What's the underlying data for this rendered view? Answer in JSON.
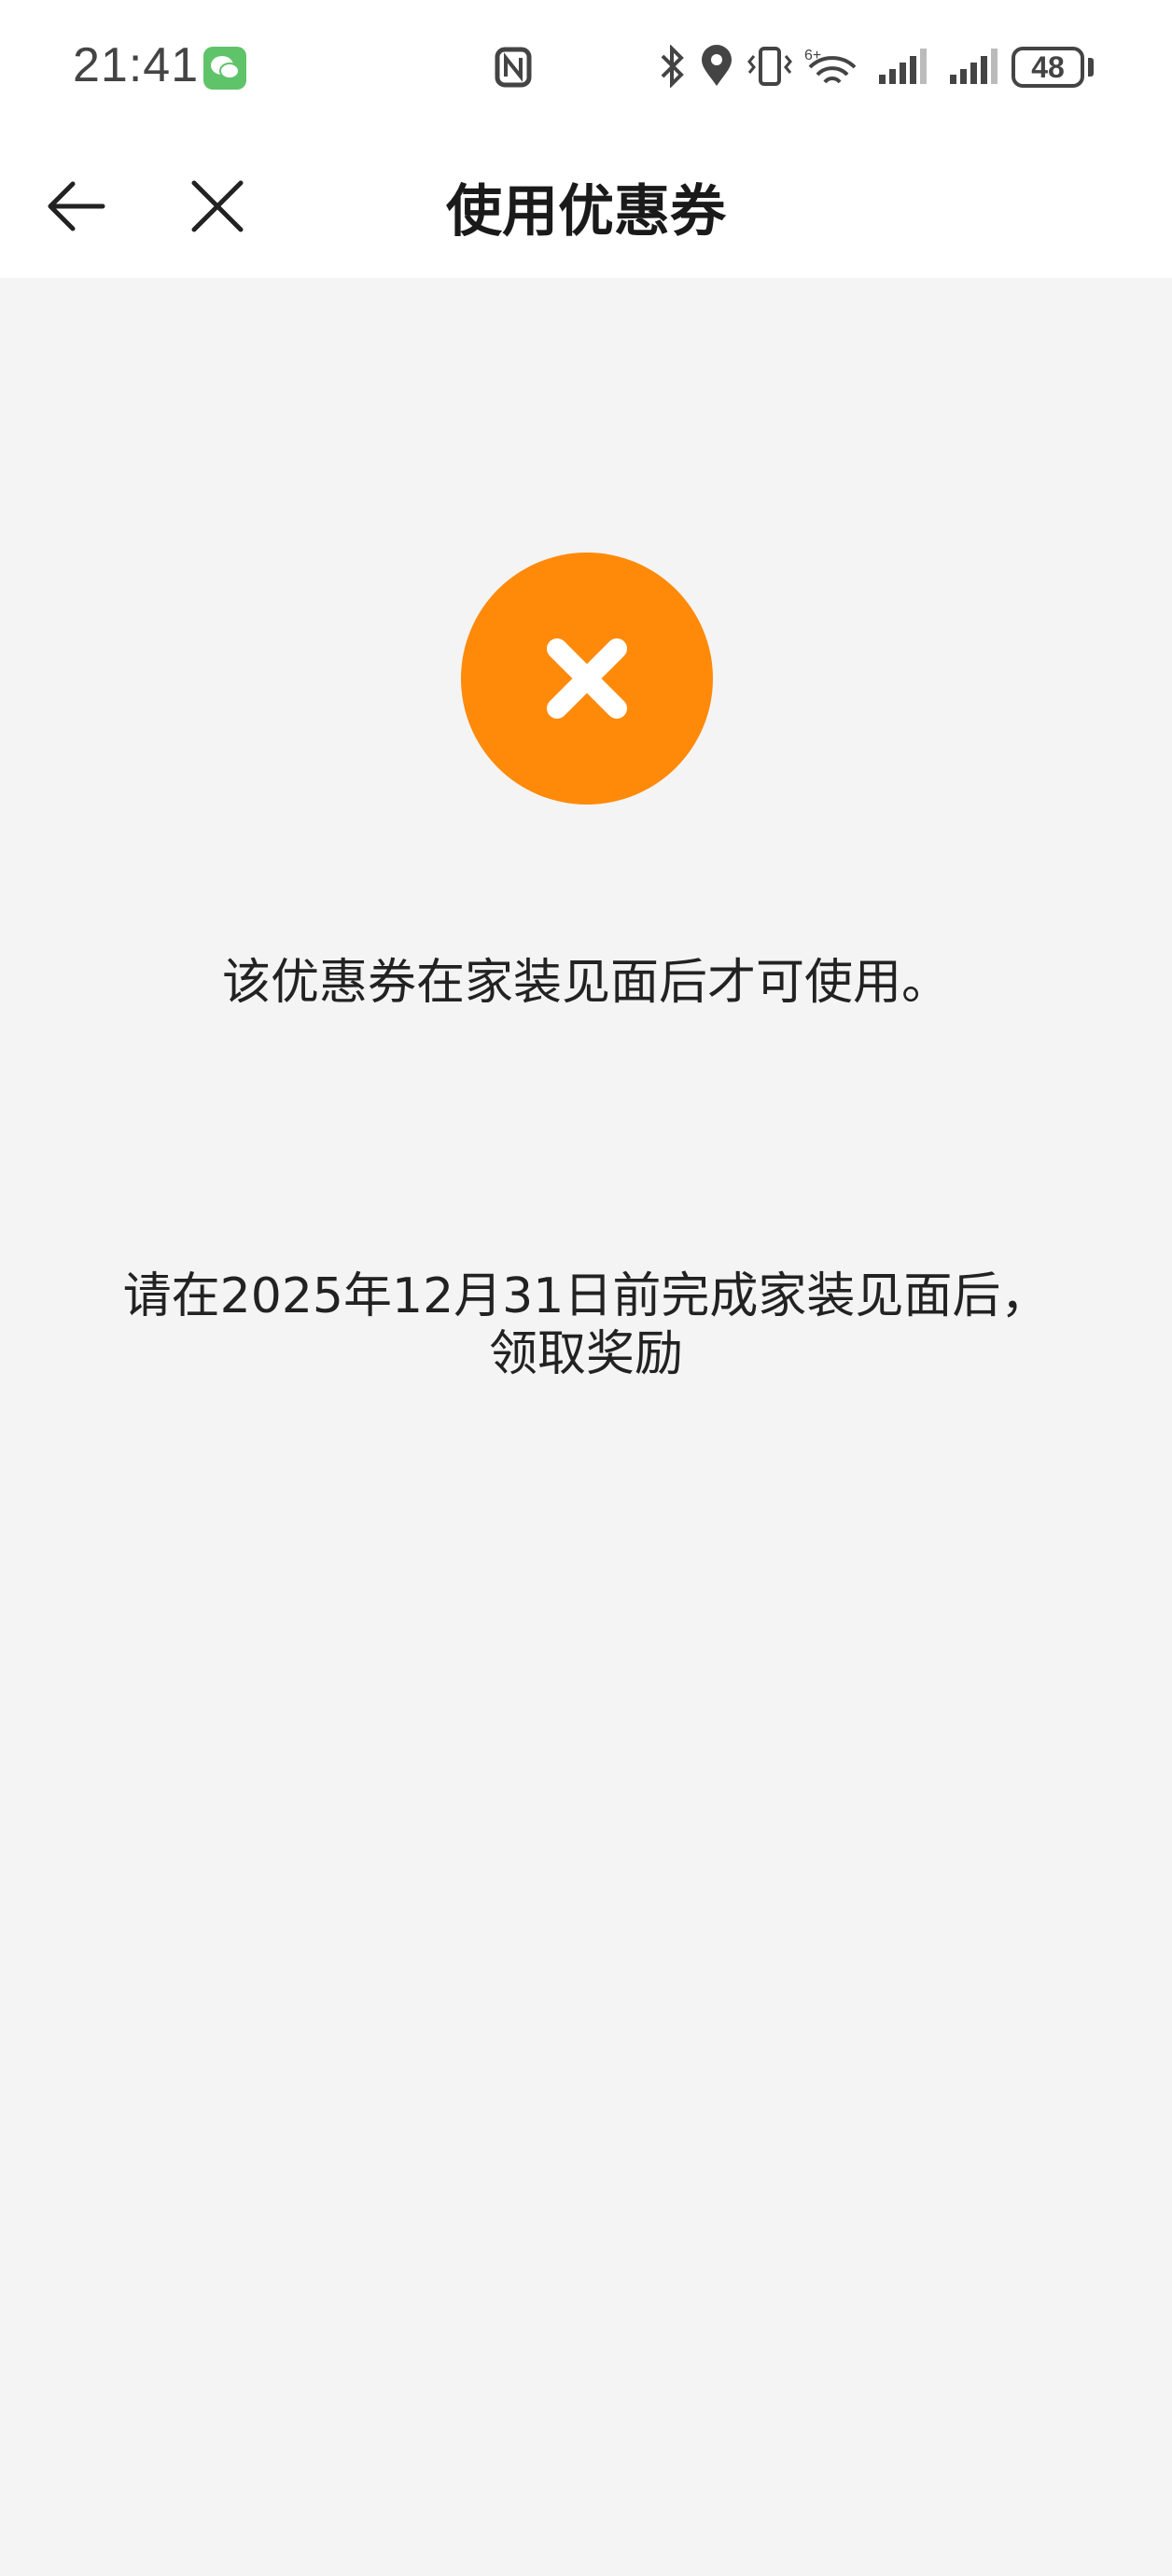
{
  "status_bar": {
    "time": "21:41",
    "battery": "48",
    "icons": [
      "wechat-icon",
      "nfc-icon",
      "bluetooth-icon",
      "location-icon",
      "vibrate-icon",
      "wifi-icon",
      "signal-icon",
      "signal-icon"
    ]
  },
  "nav": {
    "title": "使用优惠券",
    "back_icon": "back-arrow-icon",
    "close_icon": "close-icon"
  },
  "result": {
    "icon": "error-x-icon",
    "accent_color": "#ff8a0a",
    "message": "该优惠券在家装见面后才可使用。",
    "deadline_line1": "请在2025年12月31日前完成家装见面后，",
    "deadline_line2": "领取奖励"
  }
}
